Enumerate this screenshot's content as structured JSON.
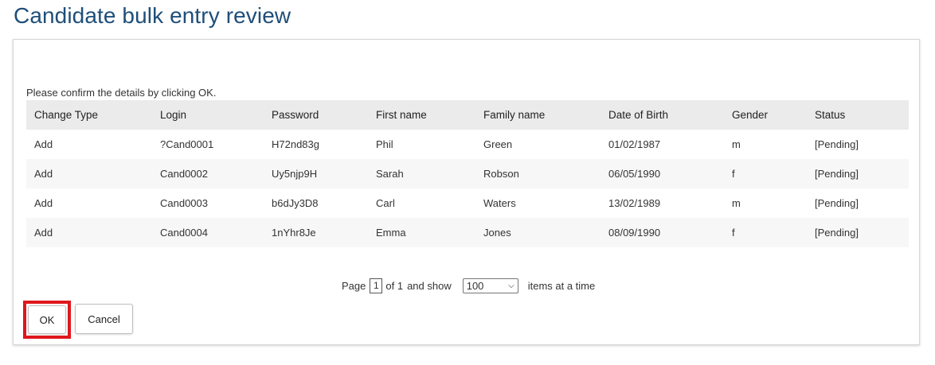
{
  "page": {
    "title": "Candidate bulk entry review"
  },
  "instruction": "Please confirm the details by clicking OK.",
  "table": {
    "headers": [
      "Change Type",
      "Login",
      "Password",
      "First name",
      "Family name",
      "Date of Birth",
      "Gender",
      "Status"
    ],
    "rows": [
      [
        "Add",
        "?Cand0001",
        "H72nd83g",
        "Phil",
        "Green",
        "01/02/1987",
        "m",
        "[Pending]"
      ],
      [
        "Add",
        "Cand0002",
        "Uy5njp9H",
        "Sarah",
        "Robson",
        "06/05/1990",
        "f",
        "[Pending]"
      ],
      [
        "Add",
        "Cand0003",
        "b6dJy3D8",
        "Carl",
        "Waters",
        "13/02/1989",
        "m",
        "[Pending]"
      ],
      [
        "Add",
        "Cand0004",
        "1nYhr8Je",
        "Emma",
        "Jones",
        "08/09/1990",
        "f",
        "[Pending]"
      ]
    ]
  },
  "pager": {
    "page_label": "Page",
    "current_page": "1",
    "of_label": "of 1",
    "and_show_label": "and show",
    "page_size": "100",
    "items_label": "items at a time"
  },
  "buttons": {
    "ok": "OK",
    "cancel": "Cancel"
  },
  "colors": {
    "title": "#1f4e79",
    "header_bg": "#ebebeb",
    "highlight": "#e0161d"
  }
}
